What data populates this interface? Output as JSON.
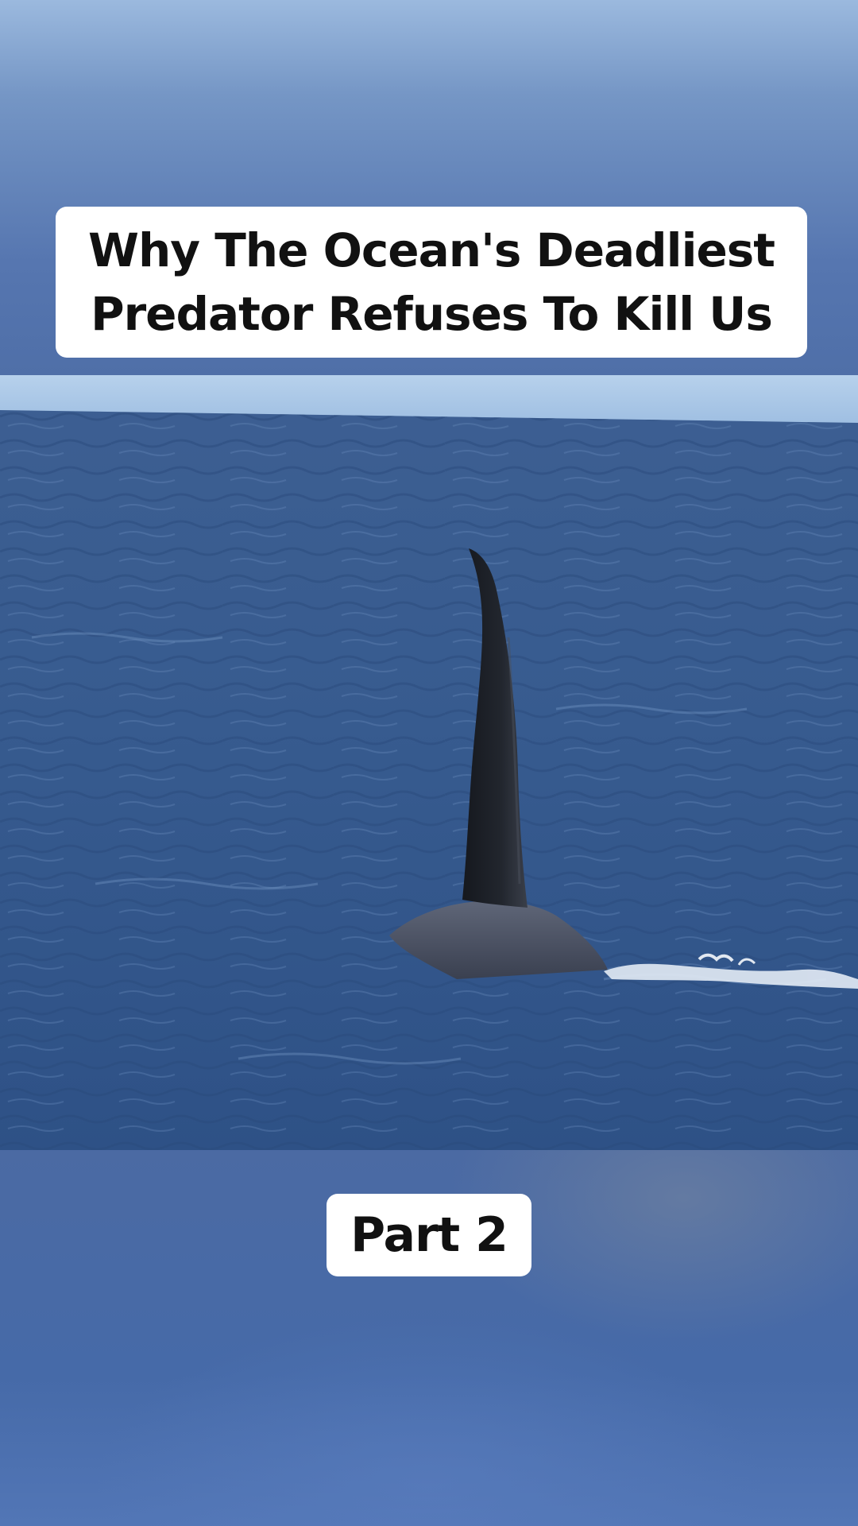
{
  "video": {
    "title_lines": [
      "Why The Ocean's Deadliest",
      "Predator Refuses To Kill Us"
    ],
    "part_label": "Part 2",
    "scene": {
      "subject": "orca-dorsal-fin",
      "colors": {
        "sky": "#a9c7e6",
        "sea_far": "#3b5f93",
        "sea_near": "#2f5286",
        "fin": "#1c1f26",
        "foam": "#e8eef5",
        "backdrop": "#4f6fa8"
      }
    }
  }
}
